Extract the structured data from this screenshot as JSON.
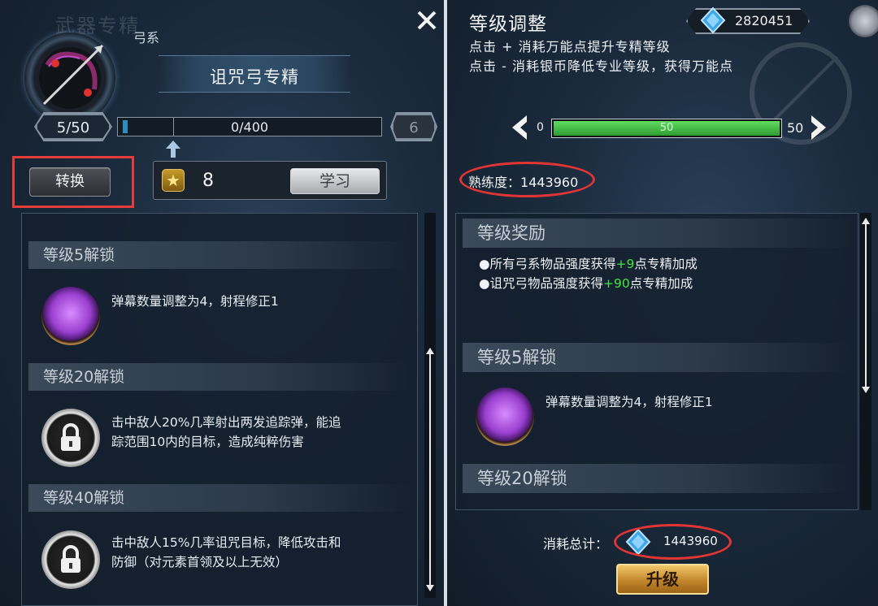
{
  "left": {
    "watermark": "武器专精",
    "bow_type": "弓系",
    "spec_title": "诅咒弓专精",
    "current_level": "5/50",
    "xp_text": "0/400",
    "xp_fraction": 0.02,
    "next_level": "6",
    "convert_label": "转换",
    "points": "8",
    "learn_label": "学习",
    "sections": [
      {
        "title": "等级5解锁",
        "desc_lines": [
          "弹幕数量调整为4，射程修正1"
        ],
        "icon": "purple-rune-icon"
      },
      {
        "title": "等级20解锁",
        "desc_lines": [
          "击中敌人20%几率射出两发追踪弹，能追",
          "踪范围10内的目标，造成纯粹伤害"
        ],
        "icon": "lock-icon"
      },
      {
        "title": "等级40解锁",
        "desc_lines": [
          "击中敌人15%几率诅咒目标，降低攻击和",
          "防御（对元素首领及以上无效）"
        ],
        "icon": "lock-icon"
      }
    ]
  },
  "right": {
    "title": "等级调整",
    "hint1": "点击 + 消耗万能点提升专精等级",
    "hint2": "点击 - 消耗银币降低专业等级，获得万能点",
    "currency": "2820451",
    "level_min": "0",
    "level_max": "50",
    "level_value": "50",
    "level_fraction": 1.0,
    "proficiency_label": "熟练度：",
    "proficiency_value": "1443960",
    "reward_section_title": "等级奖励",
    "rewards": [
      {
        "prefix": "●所有弓系物品强度获得",
        "bonus": "+9",
        "suffix": "点专精加成"
      },
      {
        "prefix": "●诅咒弓物品强度获得",
        "bonus": "+90",
        "suffix": "点专精加成"
      }
    ],
    "unlock5_title": "等级5解锁",
    "unlock5_desc": "弹幕数量调整为4，射程修正1",
    "unlock20_title": "等级20解锁",
    "cost_label": "消耗总计：",
    "cost_value": "1443960",
    "upgrade_label": "升级"
  },
  "colors": {
    "highlight_red": "#e43b3b",
    "green_bonus": "#46e23f",
    "upgrade_gold": "#c3862b",
    "xp_blue": "#2a8ec0"
  }
}
